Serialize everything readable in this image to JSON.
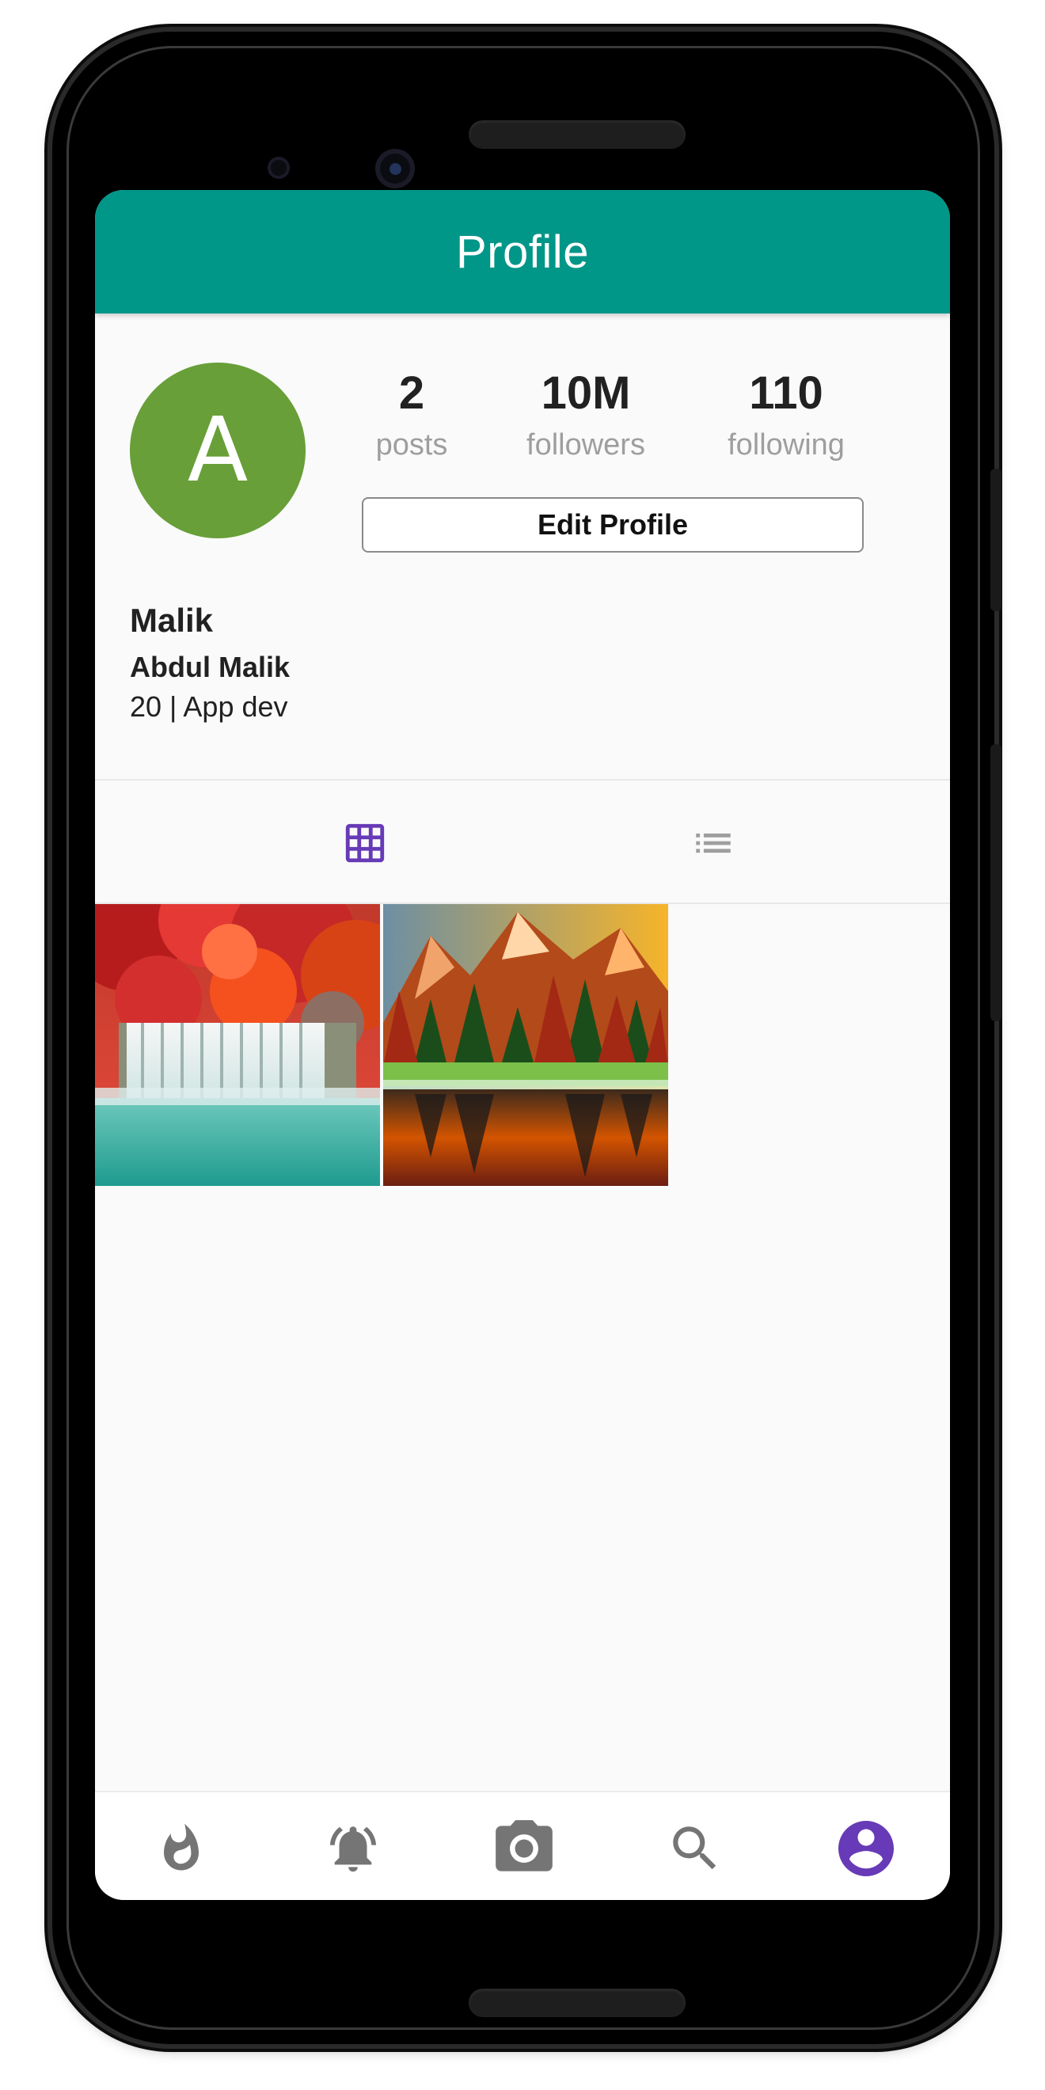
{
  "app_bar": {
    "title": "Profile"
  },
  "profile": {
    "avatar_letter": "A",
    "avatar_color": "#689f38",
    "stats": {
      "posts": {
        "value": "2",
        "label": "posts"
      },
      "followers": {
        "value": "10M",
        "label": "followers"
      },
      "following": {
        "value": "110",
        "label": "following"
      }
    },
    "edit_button_label": "Edit Profile",
    "username": "Malik",
    "full_name": "Abdul Malik",
    "bio": "20 | App dev"
  },
  "view_toggle": {
    "options": [
      "grid-icon",
      "list-icon"
    ],
    "selected": "grid-icon",
    "active_color": "#673ab7",
    "inactive_color": "#9e9e9e"
  },
  "posts_grid": [
    {
      "subject": "waterfall with red autumn foliage"
    },
    {
      "subject": "mountain forest lake at sunset"
    }
  ],
  "bottom_nav": {
    "items": [
      "flame-icon",
      "bell-ring-icon",
      "camera-icon",
      "search-icon",
      "account-circle-icon"
    ],
    "selected": "account-circle-icon"
  },
  "colors": {
    "primary": "#009688",
    "accent": "#673ab7",
    "background": "#fafafa"
  }
}
